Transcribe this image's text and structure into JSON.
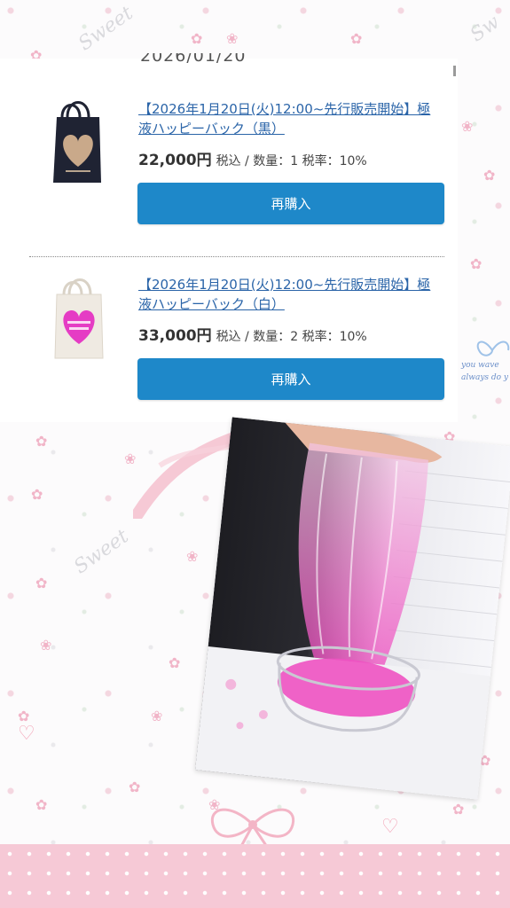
{
  "header": {
    "order_date_partial": "2026/01/20"
  },
  "items": [
    {
      "title": "【2026年1月20日(火)12:00~先行販売開始】極液ハッピーバック（黒）",
      "price": "22,000円",
      "details": "税込 / 数量：1 税率：10%",
      "rebuy_label": "再購入",
      "bag_color": "#1f2333",
      "heart_color": "#c9a98a"
    },
    {
      "title": "【2026年1月20日(火)12:00~先行販売開始】極液ハッピーバック（白）",
      "price": "33,000円",
      "details": "税込 / 数量：2 税率：10%",
      "rebuy_label": "再購入",
      "bag_color": "#efeae2",
      "heart_color": "#e53cc4"
    }
  ],
  "decor": {
    "side_note_line1": "you wave",
    "side_note_line2": "always do y",
    "accent_pink": "#f6c9d6",
    "button_blue": "#1e88c9",
    "link_blue": "#2a64a8"
  }
}
